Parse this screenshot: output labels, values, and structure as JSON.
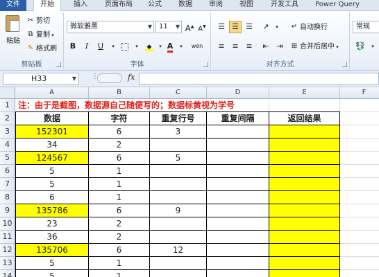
{
  "tabs": [
    "文件",
    "开始",
    "插入",
    "页面布局",
    "公式",
    "数据",
    "审阅",
    "视图",
    "开发工具",
    "Power Query"
  ],
  "clipboard": {
    "paste_label": "粘贴",
    "cut_label": "剪切",
    "copy_label": "复制",
    "format_painter_label": "格式刷",
    "group_label": "剪贴板"
  },
  "font": {
    "font_name": "微软雅黑",
    "font_size": "11",
    "grow_label": "A",
    "shrink_label": "A",
    "bold_label": "B",
    "italic_label": "I",
    "underline_label": "U",
    "wen_label": "wén",
    "group_label": "字体"
  },
  "alignment": {
    "wrap_label": "自动换行",
    "merge_label": "合并后居中",
    "group_label": "对齐方式"
  },
  "number": {
    "format_value": "常规"
  },
  "formula_bar": {
    "name_box": "H33",
    "fx_label": "fx",
    "content": ""
  },
  "columns": [
    "A",
    "B",
    "C",
    "D",
    "E",
    "F"
  ],
  "note_text": "注：由于是截图，数据源自己随便写的；数据标黄视为学号",
  "table_headers": [
    "数据",
    "字符",
    "重复行号",
    "重复间隔",
    "返回结果"
  ],
  "rows": [
    {
      "row": "1"
    },
    {
      "row": "2"
    },
    {
      "row": "3",
      "data": "152301",
      "chars": "6",
      "repeat_row": "3",
      "interval": "",
      "result": ""
    },
    {
      "row": "4",
      "data": "34",
      "chars": "2",
      "repeat_row": "",
      "interval": "",
      "result": ""
    },
    {
      "row": "5",
      "data": "124567",
      "chars": "6",
      "repeat_row": "5",
      "interval": "",
      "result": ""
    },
    {
      "row": "6",
      "data": "5",
      "chars": "1",
      "repeat_row": "",
      "interval": "",
      "result": ""
    },
    {
      "row": "7",
      "data": "5",
      "chars": "1",
      "repeat_row": "",
      "interval": "",
      "result": ""
    },
    {
      "row": "8",
      "data": "6",
      "chars": "1",
      "repeat_row": "",
      "interval": "",
      "result": ""
    },
    {
      "row": "9",
      "data": "135786",
      "chars": "6",
      "repeat_row": "9",
      "interval": "",
      "result": ""
    },
    {
      "row": "10",
      "data": "23",
      "chars": "2",
      "repeat_row": "",
      "interval": "",
      "result": ""
    },
    {
      "row": "11",
      "data": "36",
      "chars": "2",
      "repeat_row": "",
      "interval": "",
      "result": ""
    },
    {
      "row": "12",
      "data": "135706",
      "chars": "6",
      "repeat_row": "12",
      "interval": "",
      "result": ""
    },
    {
      "row": "13",
      "data": "5",
      "chars": "1",
      "repeat_row": "",
      "interval": "",
      "result": ""
    },
    {
      "row": "14",
      "data": "5",
      "chars": "1",
      "repeat_row": "",
      "interval": "",
      "result": ""
    }
  ],
  "colors": {
    "highlight": "#ffff00",
    "note_red": "#e0231c",
    "file_tab": "#2a5fa8"
  }
}
